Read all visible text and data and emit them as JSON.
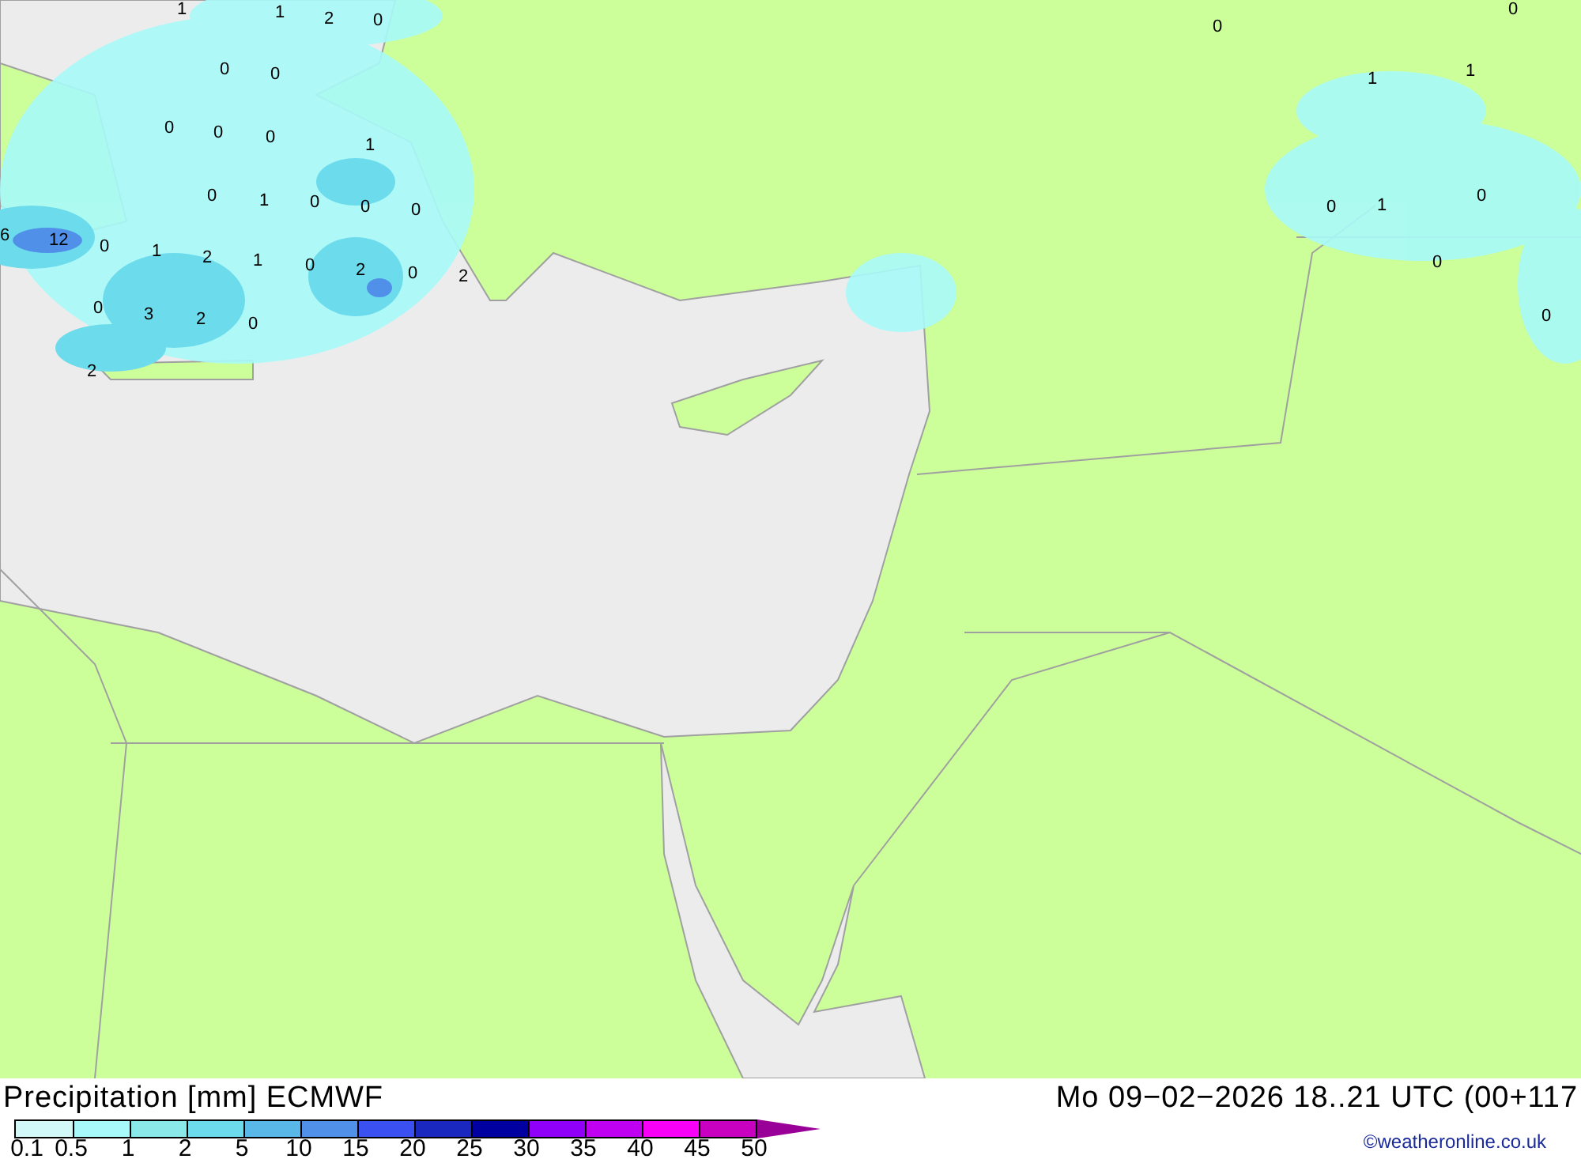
{
  "map": {
    "value_labels": [
      "1",
      "1",
      "2",
      "0",
      "0",
      "0",
      "0",
      "0",
      "0",
      "1",
      "0",
      "1",
      "0",
      "0",
      "0",
      "6",
      "12",
      "0",
      "1",
      "2",
      "1",
      "0",
      "2",
      "0",
      "2",
      "0",
      "3",
      "2",
      "0",
      "2",
      "0",
      "0",
      "1",
      "1",
      "0",
      "1",
      "0",
      "0",
      "0"
    ]
  },
  "title": "Precipitation [mm] ECMWF",
  "valid_time": "Mo 09−02−2026 18..21 UTC (00+117",
  "legend": {
    "bins": [
      {
        "color": "#d2f8f8"
      },
      {
        "color": "#a8fafa"
      },
      {
        "color": "#8ae8e8"
      },
      {
        "color": "#6cdcec"
      },
      {
        "color": "#5ab8e8"
      },
      {
        "color": "#5090e8"
      },
      {
        "color": "#3a50f0"
      },
      {
        "color": "#1a28c0"
      },
      {
        "color": "#0000a0"
      },
      {
        "color": "#9000f8"
      },
      {
        "color": "#c000f0"
      },
      {
        "color": "#f800f8"
      },
      {
        "color": "#c800c0"
      }
    ],
    "overflow": {
      "color": "#980098"
    },
    "ticks": [
      "0.1",
      "0.5",
      "1",
      "2",
      "5",
      "10",
      "15",
      "20",
      "25",
      "30",
      "35",
      "40",
      "45",
      "50"
    ]
  },
  "copyright": "©weatheronline.co.uk"
}
